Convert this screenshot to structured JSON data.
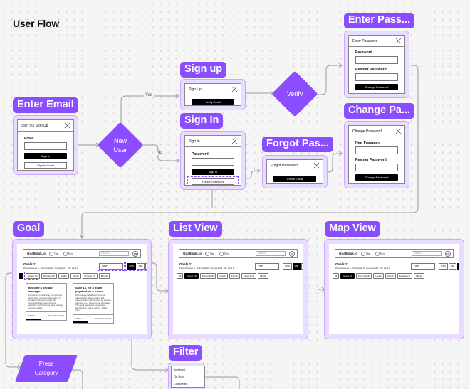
{
  "page_title": "User Flow",
  "labels": {
    "enter_email": "Enter Email",
    "sign_up": "Sign up",
    "sign_in": "Sign In",
    "forgot_password": "Forgot Pas...",
    "enter_password": "Enter Pass...",
    "change_password": "Change Pa...",
    "goal": "Goal",
    "list_view": "List View",
    "map_view": "Map View",
    "filter": "Filter"
  },
  "decisions": {
    "new_user": [
      "New",
      "User"
    ],
    "verify": "Verify",
    "press_category": [
      "Press",
      "Category"
    ]
  },
  "connector_labels": {
    "yes": "Yes",
    "no": "No"
  },
  "screens": {
    "enter_email": {
      "header": "Sign In | Sign Up",
      "field_label": "Email",
      "primary": "Sign In",
      "secondary": "Sign In Gmail"
    },
    "sign_up": {
      "header": "Sign Up",
      "primary": "Verify Email"
    },
    "sign_in": {
      "header": "Sign In",
      "field_label": "Password",
      "primary": "Sign In",
      "secondary": "Forgot Password"
    },
    "forgot_password": {
      "header": "Forgot Password",
      "primary": "Check Email"
    },
    "enter_password": {
      "header": "Enter Password",
      "field1": "Password",
      "field2": "Reenter Password",
      "primary": "Change Password"
    },
    "change_password": {
      "header": "Change Password",
      "field1": "New Password",
      "field2": "Reenter Password",
      "primary": "Change Password"
    }
  },
  "app": {
    "logo": "Goalbook.io",
    "pill1": "The",
    "pill2": "Ten",
    "search_placeholder": "Search",
    "avatar": "SM",
    "goals_title": "Goals 11",
    "goals_sub": "Parents Goals 3 · Sub Goals 8 · Completed 1 · On Hold 0",
    "filter_placeholder": "Filter",
    "view_options": [
      "Grid",
      "List",
      "Map"
    ],
    "chips_goal": [
      "Career (4)",
      "Personal (4)",
      "Health",
      "Family",
      "Finance (4)",
      "Mental"
    ],
    "chips_views": [
      "All",
      "Career (4)",
      "Personal (4)",
      "Health",
      "Family",
      "Finance (4)",
      "Mental"
    ],
    "cards": [
      {
        "title": "Become a product manager",
        "body": "Focused on advancing one's career within their current organization. It involves increasing one's job responsibilities, gaining more authority and influence, and earning a higher salary.",
        "tags": [
          "Career",
          "Finance"
        ],
        "foot_left": "12 Oct",
        "foot_right": "Days Remaining"
      },
      {
        "title": "Save 1$. for a down payment on a house",
        "body": "Achieving a significant financial milestone of accumulating 10k rupees, which will be used as a down payment on a future home purchase. This goal requires a systematic approach to saving money, which may...",
        "tags": [
          "Finance"
        ],
        "foot_left": "17 Nov",
        "foot_right": "Days Remaining"
      }
    ]
  },
  "filter_menu": [
    "Archived",
    "On Hold",
    "Completed"
  ]
}
